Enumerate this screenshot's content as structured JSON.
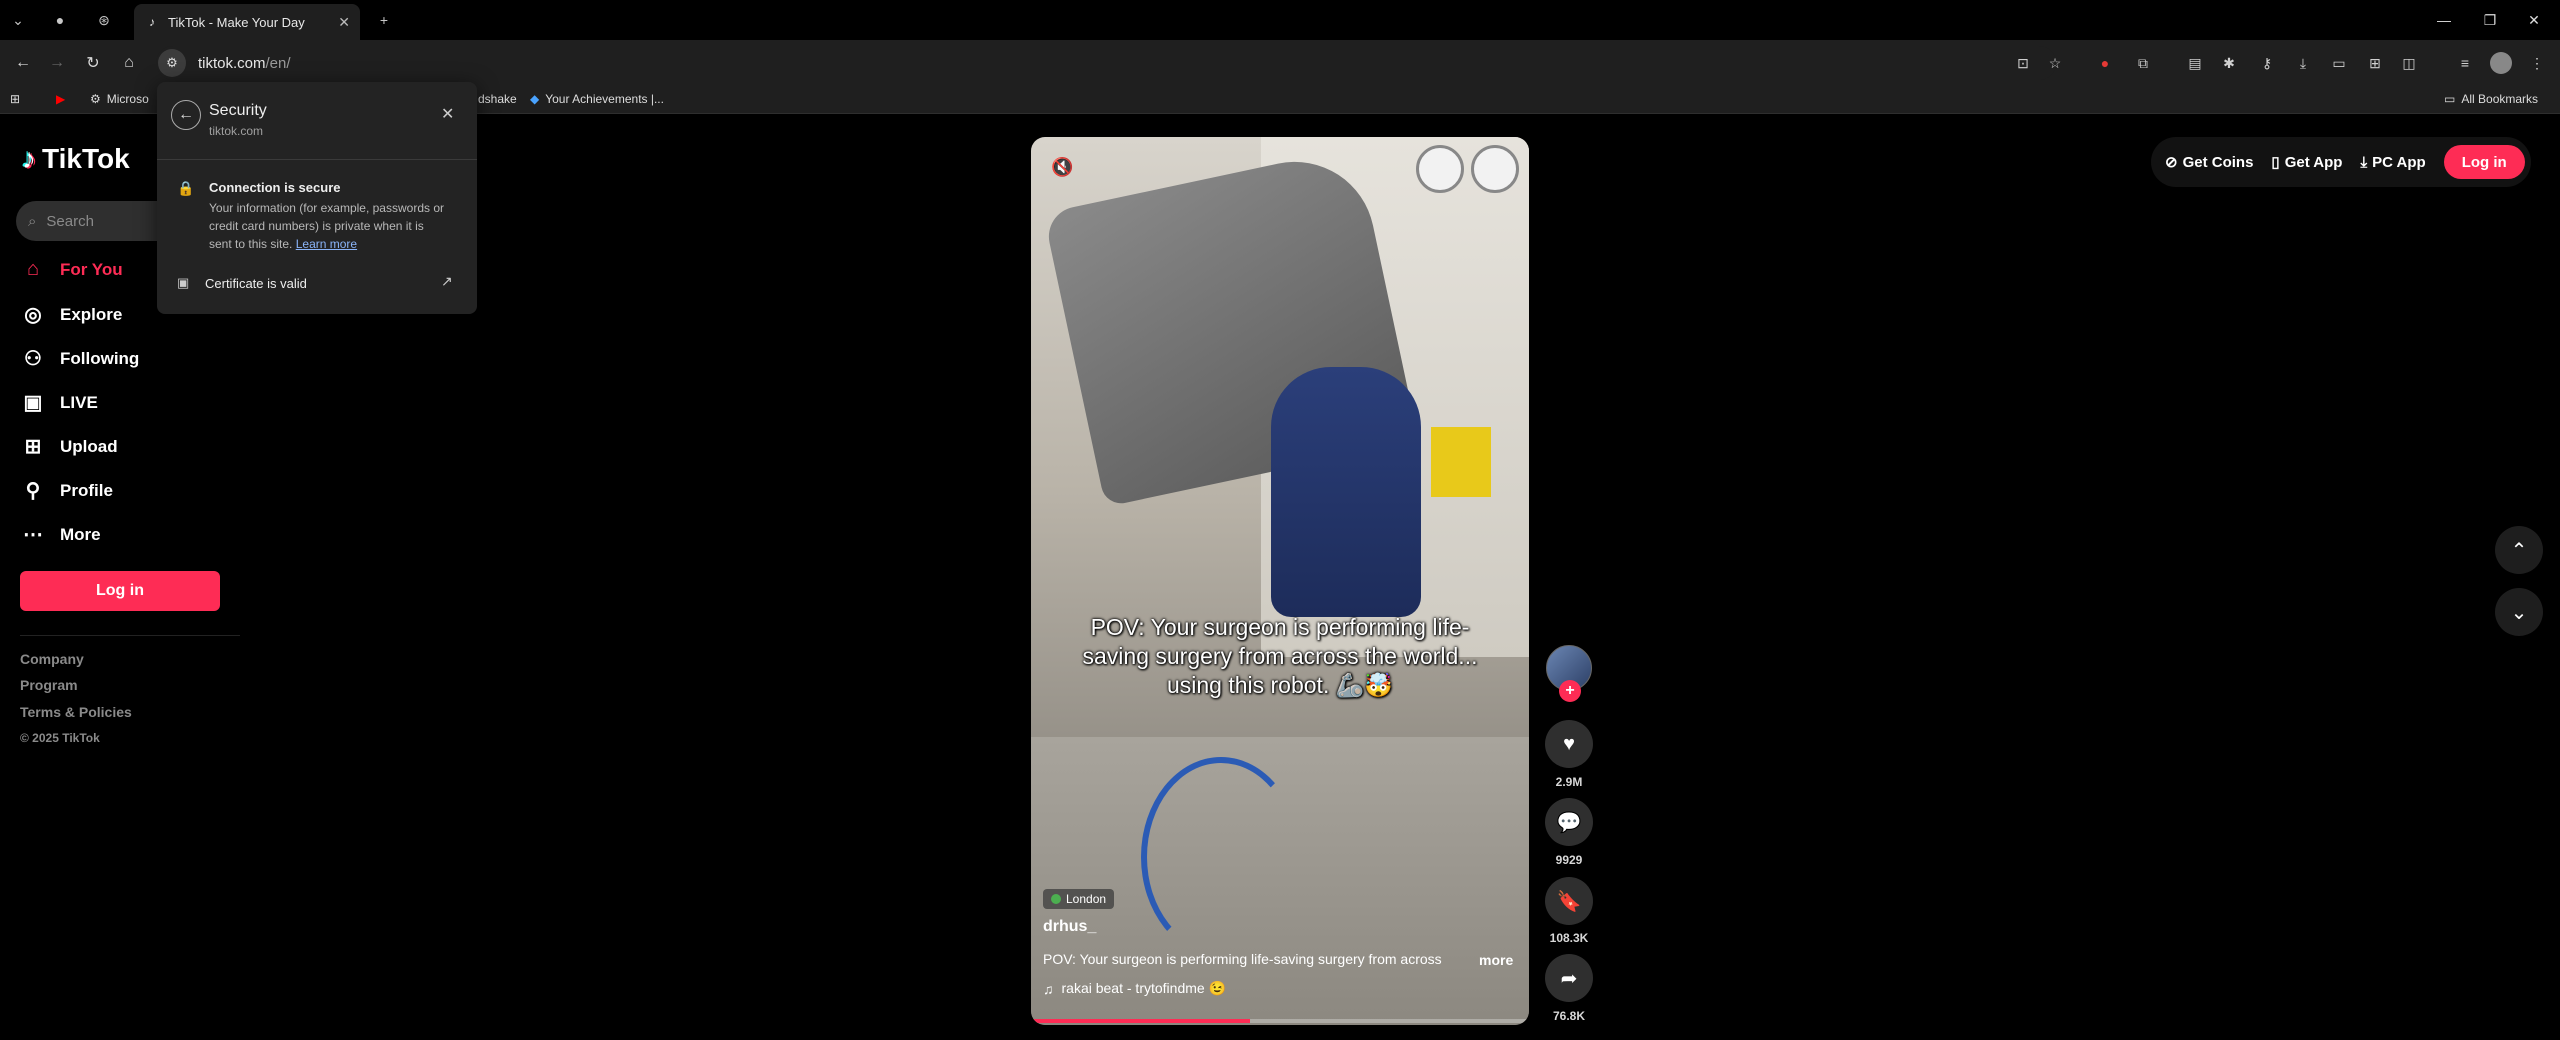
{
  "browser": {
    "tab_title": "TikTok - Make Your Day",
    "url_host": "tiktok.com",
    "url_path": "/en/",
    "bookmarks": [
      "Microso",
      "dshake",
      "Your Achievements |..."
    ],
    "all_bookmarks": "All Bookmarks"
  },
  "security_popup": {
    "title": "Security",
    "domain": "tiktok.com",
    "connection_title": "Connection is secure",
    "connection_text": "Your information (for example, passwords or credit card numbers) is private when it is sent to this site.",
    "learn_more": "Learn more",
    "certificate": "Certificate is valid"
  },
  "sidebar": {
    "logo": "TikTok",
    "search_placeholder": "Search",
    "nav": [
      {
        "label": "For You",
        "icon": "home-icon",
        "active": true
      },
      {
        "label": "Explore",
        "icon": "compass-icon"
      },
      {
        "label": "Following",
        "icon": "following-icon"
      },
      {
        "label": "LIVE",
        "icon": "live-icon"
      },
      {
        "label": "Upload",
        "icon": "upload-icon"
      },
      {
        "label": "Profile",
        "icon": "profile-icon"
      },
      {
        "label": "More",
        "icon": "more-icon"
      }
    ],
    "login": "Log in",
    "footer": [
      "Company",
      "Program",
      "Terms & Policies"
    ],
    "copyright": "© 2025 TikTok"
  },
  "header": {
    "get_coins": "Get Coins",
    "get_app": "Get App",
    "pc_app": "PC App",
    "login": "Log in"
  },
  "video": {
    "caption_overlay": "POV: Your surgeon is performing life-saving surgery from across the world... using this robot. 🦾🤯",
    "location": "London",
    "username": "drhus_",
    "description": "POV: Your surgeon is performing life-saving surgery from across",
    "more": "more",
    "music": "rakai beat - trytofindme 😉",
    "progress": 0.44
  },
  "actions": {
    "likes": "2.9M",
    "comments": "9929",
    "saves": "108.3K",
    "shares": "76.8K"
  },
  "colors": {
    "accent": "#fe2c55",
    "background": "#000000"
  }
}
